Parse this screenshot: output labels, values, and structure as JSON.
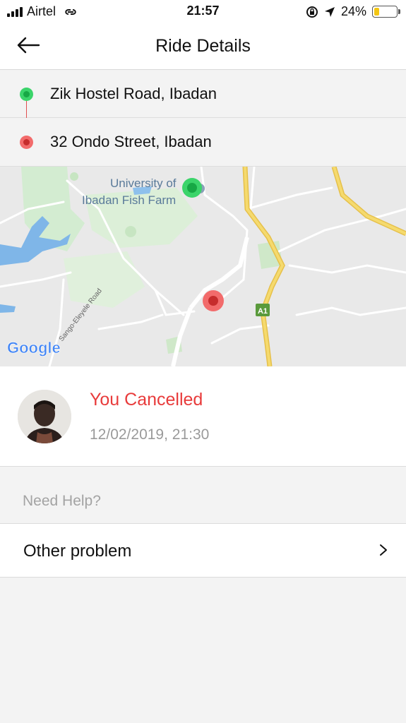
{
  "status_bar": {
    "carrier": "Airtel",
    "time": "21:57",
    "battery": "24%",
    "battery_level": 0.24
  },
  "header": {
    "title": "Ride Details"
  },
  "route": {
    "pickup": "Zik Hostel Road, Ibadan",
    "dropoff": "32 Ondo Street, Ibadan"
  },
  "map": {
    "place_label_line1": "University of",
    "place_label_line2": "Ibadan Fish Farm",
    "road_label": "Sango-Eleyele Road",
    "highway_badge": "A1",
    "attribution": "Google"
  },
  "ride": {
    "status": "You Cancelled",
    "datetime": "12/02/2019, 21:30"
  },
  "help": {
    "section_label": "Need Help?",
    "problem_label": "Other problem"
  },
  "colors": {
    "pickup": "#3bd46a",
    "dropoff": "#f26b6b",
    "cancelled": "#e83b3b",
    "battery": "#f3c614"
  }
}
